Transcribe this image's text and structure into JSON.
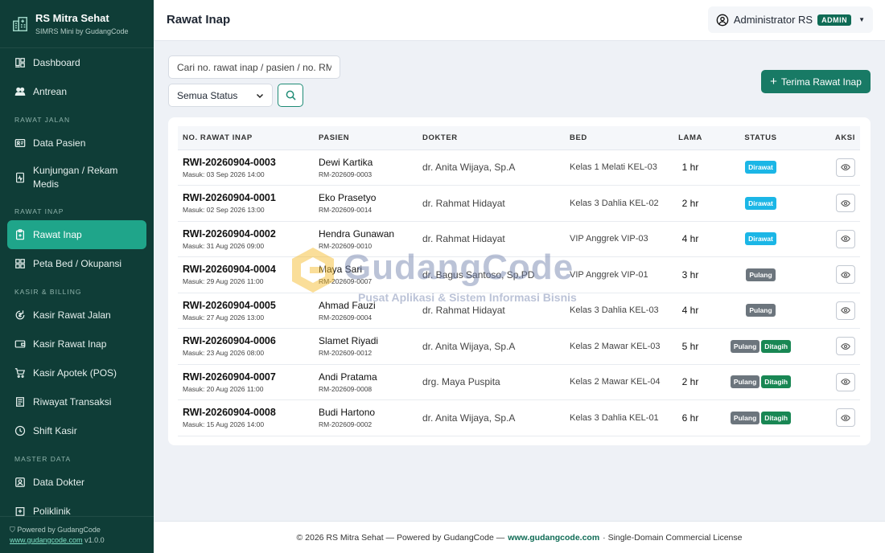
{
  "brand": {
    "title": "RS Mitra Sehat",
    "subtitle": "SIMRS Mini by GudangCode"
  },
  "sidebar": {
    "items": [
      {
        "type": "item",
        "label": "Dashboard",
        "icon": "dashboard-icon"
      },
      {
        "type": "item",
        "label": "Antrean",
        "icon": "users-icon"
      },
      {
        "type": "section",
        "label": "RAWAT JALAN"
      },
      {
        "type": "item",
        "label": "Data Pasien",
        "icon": "id-card-icon"
      },
      {
        "type": "item",
        "label": "Kunjungan / Rekam Medis",
        "icon": "medical-record-icon"
      },
      {
        "type": "section",
        "label": "RAWAT INAP"
      },
      {
        "type": "item",
        "label": "Rawat Inap",
        "icon": "clipboard-icon",
        "active": true
      },
      {
        "type": "item",
        "label": "Peta Bed / Okupansi",
        "icon": "grid-icon"
      },
      {
        "type": "section",
        "label": "KASIR & BILLING"
      },
      {
        "type": "item",
        "label": "Kasir Rawat Jalan",
        "icon": "cash-icon"
      },
      {
        "type": "item",
        "label": "Kasir Rawat Inap",
        "icon": "wallet-icon"
      },
      {
        "type": "item",
        "label": "Kasir Apotek (POS)",
        "icon": "cart-icon"
      },
      {
        "type": "item",
        "label": "Riwayat Transaksi",
        "icon": "receipt-icon"
      },
      {
        "type": "item",
        "label": "Shift Kasir",
        "icon": "clock-icon"
      },
      {
        "type": "section",
        "label": "MASTER DATA"
      },
      {
        "type": "item",
        "label": "Data Dokter",
        "icon": "doctor-icon"
      },
      {
        "type": "item",
        "label": "Poliklinik",
        "icon": "hospital-icon"
      }
    ],
    "footer": {
      "powered": "Powered by GudangCode",
      "link": "www.gudangcode.com",
      "version": "v1.0.0"
    }
  },
  "header": {
    "title": "Rawat Inap",
    "user": "Administrator RS",
    "role": "ADMIN"
  },
  "filters": {
    "search_placeholder": "Cari no. rawat inap / pasien / no. RM",
    "status_value": "Semua Status",
    "add_label": "Terima Rawat Inap"
  },
  "table": {
    "columns": [
      "NO. RAWAT INAP",
      "PASIEN",
      "DOKTER",
      "BED",
      "LAMA",
      "STATUS",
      "AKSI"
    ],
    "rows": [
      {
        "no": "RWI-20260904-0003",
        "masuk": "Masuk: 03 Sep 2026 14:00",
        "pasien": "Dewi Kartika",
        "rm": "RM-202609-0003",
        "dokter": "dr. Anita Wijaya, Sp.A",
        "bed": "Kelas 1 Melati KEL-03",
        "lama": "1 hr",
        "status": [
          "Dirawat"
        ]
      },
      {
        "no": "RWI-20260904-0001",
        "masuk": "Masuk: 02 Sep 2026 13:00",
        "pasien": "Eko Prasetyo",
        "rm": "RM-202609-0014",
        "dokter": "dr. Rahmat Hidayat",
        "bed": "Kelas 3 Dahlia KEL-02",
        "lama": "2 hr",
        "status": [
          "Dirawat"
        ]
      },
      {
        "no": "RWI-20260904-0002",
        "masuk": "Masuk: 31 Aug 2026 09:00",
        "pasien": "Hendra Gunawan",
        "rm": "RM-202609-0010",
        "dokter": "dr. Rahmat Hidayat",
        "bed": "VIP Anggrek VIP-03",
        "lama": "4 hr",
        "status": [
          "Dirawat"
        ]
      },
      {
        "no": "RWI-20260904-0004",
        "masuk": "Masuk: 29 Aug 2026 11:00",
        "pasien": "Maya Sari",
        "rm": "RM-202609-0007",
        "dokter": "dr. Bagus Santoso, Sp.PD",
        "bed": "VIP Anggrek VIP-01",
        "lama": "3 hr",
        "status": [
          "Pulang"
        ]
      },
      {
        "no": "RWI-20260904-0005",
        "masuk": "Masuk: 27 Aug 2026 13:00",
        "pasien": "Ahmad Fauzi",
        "rm": "RM-202609-0004",
        "dokter": "dr. Rahmat Hidayat",
        "bed": "Kelas 3 Dahlia KEL-03",
        "lama": "4 hr",
        "status": [
          "Pulang"
        ]
      },
      {
        "no": "RWI-20260904-0006",
        "masuk": "Masuk: 23 Aug 2026 08:00",
        "pasien": "Slamet Riyadi",
        "rm": "RM-202609-0012",
        "dokter": "dr. Anita Wijaya, Sp.A",
        "bed": "Kelas 2 Mawar KEL-03",
        "lama": "5 hr",
        "status": [
          "Pulang",
          "Ditagih"
        ]
      },
      {
        "no": "RWI-20260904-0007",
        "masuk": "Masuk: 20 Aug 2026 11:00",
        "pasien": "Andi Pratama",
        "rm": "RM-202609-0008",
        "dokter": "drg. Maya Puspita",
        "bed": "Kelas 2 Mawar KEL-04",
        "lama": "2 hr",
        "status": [
          "Pulang",
          "Ditagih"
        ]
      },
      {
        "no": "RWI-20260904-0008",
        "masuk": "Masuk: 15 Aug 2026 14:00",
        "pasien": "Budi Hartono",
        "rm": "RM-202609-0002",
        "dokter": "dr. Anita Wijaya, Sp.A",
        "bed": "Kelas 3 Dahlia KEL-01",
        "lama": "6 hr",
        "status": [
          "Pulang",
          "Ditagih"
        ]
      }
    ]
  },
  "watermark": {
    "title": "GudangCode",
    "subtitle": "Pusat Aplikasi & Sistem Informasi Bisnis"
  },
  "footer": {
    "prefix": "© 2026 RS Mitra Sehat — Powered by GudangCode —",
    "link": "www.gudangcode.com",
    "suffix": "· Single-Domain Commercial License"
  },
  "colors": {
    "sidebar": "#0f3d37",
    "active": "#1fa58a",
    "primary": "#187a65",
    "dirawat": "#1bb6e6",
    "pulang": "#6c757d",
    "ditagih": "#198754"
  }
}
